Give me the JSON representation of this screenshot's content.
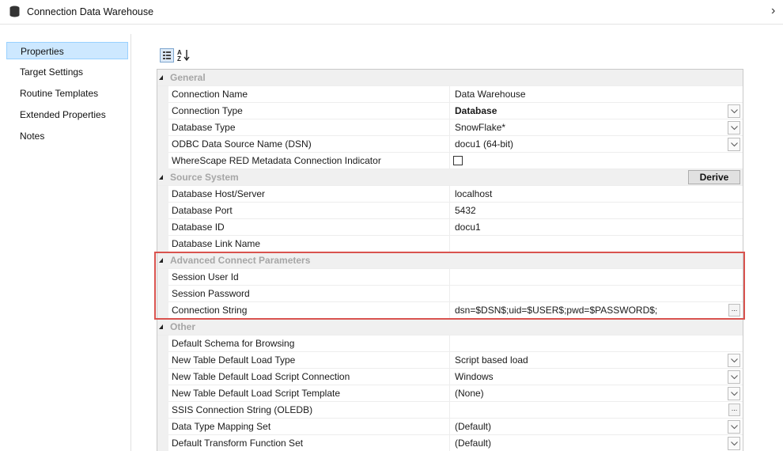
{
  "window": {
    "title": "Connection Data Warehouse",
    "icon": "database-icon"
  },
  "nav": {
    "items": [
      {
        "label": "Properties",
        "selected": true
      },
      {
        "label": "Target Settings"
      },
      {
        "label": "Routine Templates"
      },
      {
        "label": "Extended Properties"
      },
      {
        "label": "Notes"
      }
    ]
  },
  "toolbar": {
    "categorized": {
      "icon": "categorized-view-icon"
    },
    "alphabetical": {
      "icon": "sort-alphabetical-icon",
      "glyph": "A↓Z"
    }
  },
  "categories": {
    "general": "General",
    "source_system": "Source System",
    "advanced": "Advanced Connect Parameters",
    "other": "Other"
  },
  "derive_label": "Derive",
  "rows": {
    "connection_name": {
      "name": "Connection Name",
      "value": "Data Warehouse"
    },
    "connection_type": {
      "name": "Connection Type",
      "value": "Database"
    },
    "database_type": {
      "name": "Database Type",
      "value": "SnowFlake*"
    },
    "odbc_dsn": {
      "name": "ODBC Data Source Name (DSN)",
      "value": "docu1 (64-bit)"
    },
    "metadata_indicator": {
      "name": "WhereScape RED Metadata Connection Indicator",
      "checked": false
    },
    "host": {
      "name": "Database Host/Server",
      "value": "localhost"
    },
    "port": {
      "name": "Database Port",
      "value": "5432"
    },
    "db_id": {
      "name": "Database ID",
      "value": "docu1"
    },
    "db_link": {
      "name": "Database Link Name",
      "value": ""
    },
    "session_user": {
      "name": "Session User Id",
      "value": ""
    },
    "session_password": {
      "name": "Session Password",
      "value": ""
    },
    "conn_string": {
      "name": "Connection String",
      "value": "dsn=$DSN$;uid=$USER$;pwd=$PASSWORD$;"
    },
    "default_schema": {
      "name": "Default Schema for Browsing",
      "value": ""
    },
    "load_type": {
      "name": "New Table Default Load Type",
      "value": "Script based load"
    },
    "load_script_conn": {
      "name": "New Table Default Load Script Connection",
      "value": "Windows"
    },
    "load_script_template": {
      "name": "New Table Default Load Script Template",
      "value": "(None)"
    },
    "ssis_conn": {
      "name": "SSIS Connection String (OLEDB)",
      "value": ""
    },
    "type_mapping": {
      "name": "Data Type Mapping Set",
      "value": "(Default)"
    },
    "transform_set": {
      "name": "Default Transform Function Set",
      "value": "(Default)"
    }
  },
  "colors": {
    "highlight": "#d9534f",
    "selected_nav": "#cde8ff"
  }
}
